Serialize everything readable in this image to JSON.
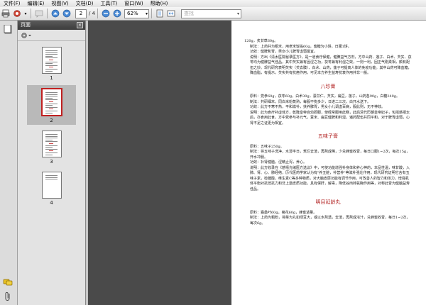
{
  "menu": [
    "文件(F)",
    "编辑(E)",
    "视图(V)",
    "文档(D)",
    "工具(T)",
    "窗口(W)",
    "帮助(H)"
  ],
  "toolbar": {
    "page_current": "2",
    "page_total": "/ 4",
    "zoom": "62%",
    "search_placeholder": "查找"
  },
  "panel": {
    "title": "页面",
    "close": "×",
    "thumbnails": [
      {
        "label": "1",
        "selected": false
      },
      {
        "label": "2",
        "selected": true
      },
      {
        "label": "3",
        "selected": false
      },
      {
        "label": "4",
        "selected": false
      }
    ]
  },
  "document": {
    "blocks": [
      {
        "type": "p",
        "text": "120g，炙甘草60g。"
      },
      {
        "type": "p",
        "indent": true,
        "text": "制法：上药共为粗末，用老米饭捣60g，蜜糖为小饼，日服1饼。"
      },
      {
        "type": "p",
        "indent": true,
        "text": "功效：健脾和胃，男女小儿脾胃虚弱最宜。"
      },
      {
        "type": "p",
        "indent": true,
        "text": "说明：方出《清太医院秘录医方》，是一道食疗保健，健脾益气方剂，方中山药、莲子、白术、芡实、茯苓均为健脾益气佳品，其中芡实兼有固涩之功，茯苓兼有利湿之效，一则一利，固正气刚柔相，颇有配伍之妙。现代研究表明芡实（芡去膜）、白术、山药，莲子可提高人体的免疫功能。其中山药可降血糖，降血脂，有提示，芡实共有抗癌作用，可见本方养生益寿抗衰作用并非一般。"
      },
      {
        "type": "h",
        "text": "八珍膏"
      },
      {
        "type": "p",
        "indent": true,
        "text": "原料：党参60g，茯苓60g，白术30g，薏苡仁，芡实，扁豆，莲子，山药各90g，白糖240g。"
      },
      {
        "type": "p",
        "indent": true,
        "text": "制法：共研细末，同白米粉蒸熟，每服不拘多少，日进二三次，白开水送下。"
      },
      {
        "type": "p",
        "indent": true,
        "text": "功效：此方不寒不热，平和滋补，扶养脾胃，男女小儿调虚百病，服此则，无不神效。"
      },
      {
        "type": "p",
        "indent": true,
        "text": "说明：此为食疗补虚佳方，乾隆皇帝自幼即服，使经常服用此糕，此后清代历朝皇帝妃子，包括慈禧太后，亦食用此食，方中党参与补元气，薏米、扁豆健脾和利湿，诸药配伍共同平和，对于脾胃虚弱，心肾不足之证更为相宜。"
      },
      {
        "type": "h",
        "text": "五味子膏"
      },
      {
        "type": "p",
        "indent": true,
        "text": "原料：五味子250g。"
      },
      {
        "type": "p",
        "indent": true,
        "text": "制法：将五味子洗净，水浸半日，煮烂去渣，再熬成稀，少兑蜂蜜收膏，每日口服1~2次，每次15g，开水冲服。"
      },
      {
        "type": "p",
        "indent": true,
        "text": "功效：补肾健脑，涩精止泻，养心。"
      },
      {
        "type": "p",
        "indent": true,
        "text": "说明：此方收录在《慈禧光绪医方选议》中，可使功能增强补身体和养心神的，本品性温，味甘酸，入肺、肾、心、肺经络，历代医药学家认为有\"养五脏，补营养\"等滋补强壮作用，现代研究证明它含有五味子素，检糖酸，维生素C等多种物质，对大脑皮层功能有调节作用，可改善人的智力和体力，增强机体平衡对抗低抗力和非上激皮质功能，具有保肝，解毒，降低谷丙转氨酶作用等，对称此膏为健脑益寿佳品。"
      },
      {
        "type": "h",
        "text": "明目延龄丸"
      },
      {
        "type": "p",
        "indent": true,
        "text": "原料：霜桑叶60g，菊花60g，蜂蜜适量。"
      },
      {
        "type": "p",
        "indent": true,
        "text": "制法：上药为粗粉，将菜为丸如绿豆大，或以水熬透，去渣，再熬成浓汁，兑蜂蜜收膏，每日1~2次，每次6g。"
      }
    ]
  },
  "colors": {
    "heading": "#b22222",
    "selection_border": "#c02020"
  }
}
